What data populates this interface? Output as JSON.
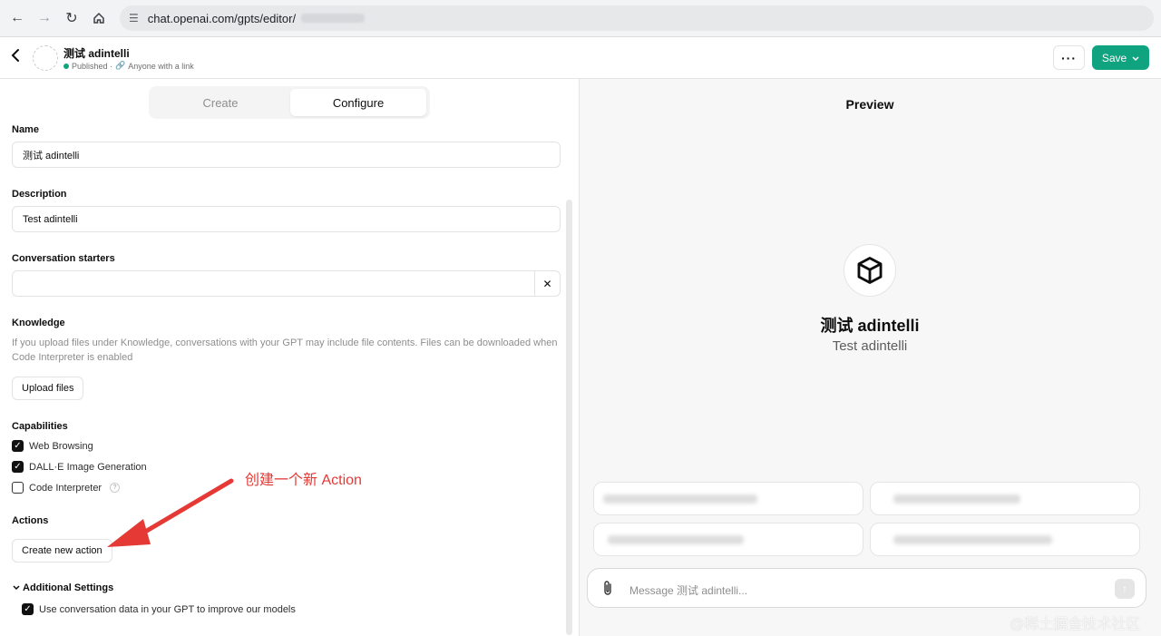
{
  "browser": {
    "url": "chat.openai.com/gpts/editor/",
    "icons": [
      "arrow-left-icon",
      "arrow-right-icon",
      "reload-icon",
      "home-icon",
      "site-settings-icon"
    ]
  },
  "header": {
    "gpt_name": "测试 adintelli",
    "status": "Published ·",
    "visibility": "Anyone with a link",
    "more_label": "···",
    "save_label": "Save",
    "accent": "#10a37f"
  },
  "tabs": {
    "create": "Create",
    "configure": "Configure",
    "active": "Configure"
  },
  "form": {
    "name_label": "Name",
    "name_value": "测试 adintelli",
    "description_label": "Description",
    "description_value": "Test adintelli",
    "starters_label": "Conversation starters",
    "starters_value": "",
    "starters_clear": "✕",
    "knowledge_label": "Knowledge",
    "knowledge_help": "If you upload files under Knowledge, conversations with your GPT may include file contents. Files can be downloaded when Code Interpreter is enabled",
    "upload_label": "Upload files",
    "capabilities_label": "Capabilities",
    "capabilities": [
      {
        "label": "Web Browsing",
        "checked": true
      },
      {
        "label": "DALL·E Image Generation",
        "checked": true
      },
      {
        "label": "Code Interpreter",
        "checked": false
      }
    ],
    "actions_label": "Actions",
    "create_action_label": "Create new action",
    "additional_label": "Additional Settings",
    "use_data_label": "Use conversation data in your GPT to improve our models",
    "use_data_checked": true
  },
  "annotation": {
    "text": "创建一个新 Action",
    "color": "#e53935"
  },
  "preview": {
    "title": "Preview",
    "gpt_name": "测试 adintelli",
    "gpt_desc": "Test adintelli",
    "message_placeholder": "Message 测试 adintelli..."
  },
  "watermark": "@稀土掘金技术社区"
}
